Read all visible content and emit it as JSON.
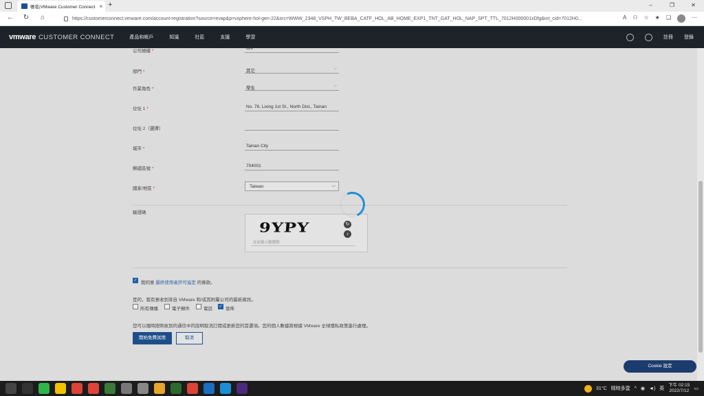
{
  "browser": {
    "tab_title": "帳名|VMware Customer Connect",
    "url": "https://customerconnect.vmware.com/account-registration?source=evap&p=vsphere-hol-gen-22&src=WWW_2348_VSPH_TW_BEBA_CATF_HOL_AB_HOME_EXP1_TNT_GAT_HOL_NAP_SPT_TTL_7012H000001xDfg&int_cid=7012H0...",
    "new_tab": "+",
    "close": "×"
  },
  "vmware": {
    "logo": "vmware",
    "logo_sub": "CUSTOMER CONNECT",
    "nav": [
      "產品和帳戶",
      "知識",
      "社區",
      "支援",
      "學習"
    ],
    "register": "註冊",
    "login": "登錄"
  },
  "form": {
    "company_size_label": "公司規模",
    "company_size_value": "ON",
    "department_label": "部門",
    "department_value": "其它",
    "job_role_label": "作業角色",
    "job_role_value": "學生",
    "address1_label": "位址 1",
    "address1_value": "No. 78, Lixing 1st St., North Dist., Tainan",
    "address2_label": "位址 2（選擇）",
    "address2_value": "",
    "city_label": "城市",
    "city_value": "Tainan City",
    "postal_label": "郵遞區號",
    "postal_value": "704001",
    "country_label": "國家/地區",
    "country_value": "Taiwan",
    "required_mark": "*",
    "captcha_label": "驗證碼",
    "captcha_text": "9YPY",
    "captcha_placeholder": "在此輸入驗證碼",
    "agree_text_prefix": "我同意",
    "agree_link": "最終使用者許可協定",
    "agree_text_suffix": "的條款。",
    "consent_question": "是的，我有意收到來自 VMware 和/或其附屬公司的最新資訊。",
    "opt_all": "所有傳播",
    "opt_email": "電子郵件",
    "opt_phone": "電話",
    "opt_mail": "發佈",
    "privacy_text": "您可以隨時按照收到的通信中的說明取消訂閱或更新您的首選項。您的個人數據將根據 VMware 全球隱私政策進行處理。",
    "submit_button": "開始免費試用",
    "cancel_button": "取消"
  },
  "cookie_button": "Cookie 設定",
  "taskbar": {
    "temperature": "31°C",
    "weather": "晴時多雲",
    "ime": "英",
    "time": "下午 02:15",
    "date": "2022/7/12"
  },
  "colors": {
    "vmware_header": "#1d2328",
    "primary_button": "#1d4e8a",
    "spinner": "#1f8fd6"
  }
}
